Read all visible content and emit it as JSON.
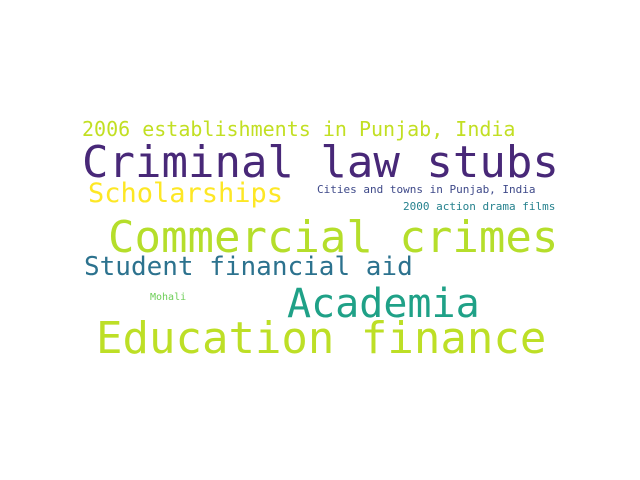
{
  "words": [
    {
      "text": "2006 establishments in Punjab, India",
      "color": "#c2df23"
    },
    {
      "text": "Criminal law stubs",
      "color": "#482878"
    },
    {
      "text": "Scholarships",
      "color": "#fde725"
    },
    {
      "text": "Cities and towns in Punjab, India",
      "color": "#3e4989"
    },
    {
      "text": "2000 action drama films",
      "color": "#26828e"
    },
    {
      "text": "Commercial crimes",
      "color": "#b5de2b"
    },
    {
      "text": "Student financial aid",
      "color": "#2c728e"
    },
    {
      "text": "Academia",
      "color": "#1fa187"
    },
    {
      "text": "Mohali",
      "color": "#6ece58"
    },
    {
      "text": "Education finance",
      "color": "#bddf26"
    }
  ]
}
